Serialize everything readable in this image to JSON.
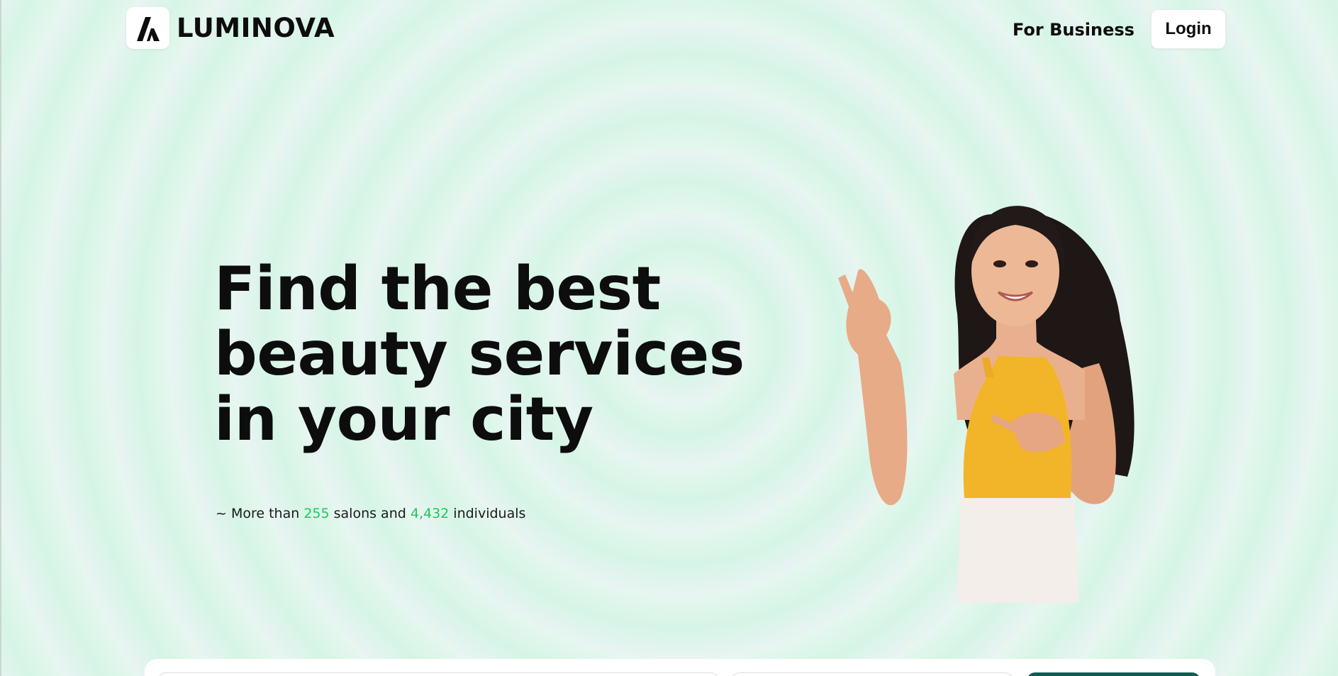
{
  "brand": {
    "name": "LUMINOVA",
    "logo_icon": "luminova-logo-icon"
  },
  "nav": {
    "for_business": "For Business",
    "login": "Login"
  },
  "hero": {
    "title_lines": [
      "Find the best",
      "beauty services",
      "in your city"
    ],
    "stats": {
      "prefix": "~ More than ",
      "salons_count": "255",
      "salons_label": " salons and ",
      "individuals_count": "4,432",
      "individuals_label": " individuals"
    },
    "image": "woman-pointing-illustration"
  },
  "colors": {
    "accent_green": "#22c55e",
    "button_dark_teal": "#0f5c52",
    "background_mint": "#d6f5e6"
  }
}
